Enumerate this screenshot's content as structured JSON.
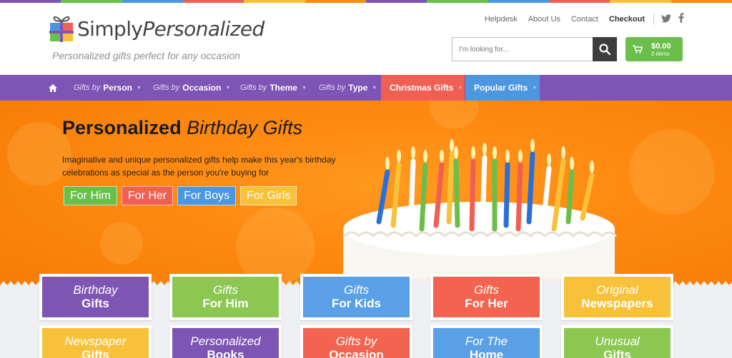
{
  "colors": {
    "purple": "#7e55b4",
    "orange": "#ff8a12",
    "green": "#6abf4b",
    "red": "#f05f54",
    "blue": "#4d96e0",
    "yellow": "#f7c23a"
  },
  "header": {
    "logo_simply": "Simply",
    "logo_personalized": "Personalized",
    "tagline": "Personalized gifts perfect for any occasion",
    "links": [
      "Helpdesk",
      "About Us",
      "Contact",
      "Checkout"
    ],
    "social": [
      "twitter-icon",
      "facebook-icon"
    ],
    "search_placeholder": "I'm looking for...",
    "cart_amount": "$0.00",
    "cart_items": "0 items"
  },
  "nav": {
    "items": [
      {
        "pre": "Gifts by",
        "main": "Person"
      },
      {
        "pre": "Gifts by",
        "main": "Occasion"
      },
      {
        "pre": "Gifts by",
        "main": "Theme"
      },
      {
        "pre": "Gifts by",
        "main": "Type"
      },
      {
        "pre": "",
        "main": "Christmas Gifts"
      },
      {
        "pre": "",
        "main": "Popular Gifts"
      }
    ]
  },
  "hero": {
    "title_bold": "Personalized",
    "title_italic": "Birthday Gifts",
    "description": "Imaginative and unique personalized gifts help make this year's birthday celebrations as special as the person you're buying for",
    "buttons": [
      "For Him",
      "For Her",
      "For Boys",
      "For Girls"
    ]
  },
  "tiles": [
    {
      "l1": "Birthday",
      "l2": "Gifts"
    },
    {
      "l1": "Gifts",
      "l2": "For Him"
    },
    {
      "l1": "Gifts",
      "l2": "For Kids"
    },
    {
      "l1": "Gifts",
      "l2": "For Her"
    },
    {
      "l1": "Original",
      "l2": "Newspapers"
    },
    {
      "l1": "Newspaper",
      "l2": "Gifts"
    },
    {
      "l1": "Personalized",
      "l2": "Books"
    },
    {
      "l1": "Gifts by",
      "l2": "Occasion"
    },
    {
      "l1": "For The",
      "l2": "Home"
    },
    {
      "l1": "Unusual",
      "l2": "Gifts"
    }
  ]
}
